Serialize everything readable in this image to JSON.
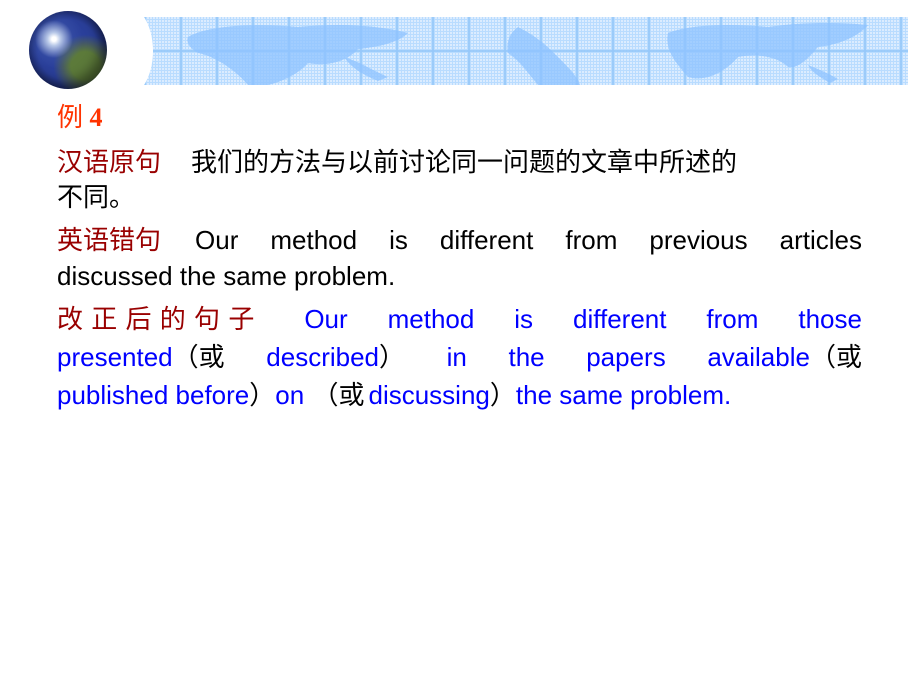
{
  "slide": {
    "example_title": {
      "prefix": "例",
      "number": "4"
    },
    "chinese_original": {
      "label": "汉语原句",
      "text_line1": "我们的方法与以前讨论同一问题的文章中所述的",
      "text_line2": "不同。"
    },
    "english_wrong": {
      "label": "英语错句",
      "line1_words": [
        "Our",
        "method",
        "is",
        "different",
        "from",
        "previous",
        "articles"
      ],
      "line2": "discussed the same problem."
    },
    "corrected": {
      "label": "改 正 后 的 句 子",
      "line1_words": [
        "Our",
        "method",
        "is",
        "different",
        "from",
        "those"
      ],
      "line2": {
        "w1": "presented",
        "p1": "（",
        "or1": "或",
        "w2": "described",
        "p2": "）",
        "w3": "in",
        "w4": "the",
        "w5": "papers",
        "w6": "available",
        "p3": "（",
        "or2": "或"
      },
      "line3": {
        "w1": "published before",
        "p1": "）",
        "w2": "on",
        "p2": " （",
        "or": "或",
        "w3": "discussing",
        "p3": "）",
        "w4": "the same problem."
      }
    },
    "colors": {
      "title_red": "#ff3300",
      "label_darkred": "#990000",
      "body_black": "#000000",
      "corrected_blue": "#0000ff",
      "banner_blue": "#b9dcff"
    }
  }
}
